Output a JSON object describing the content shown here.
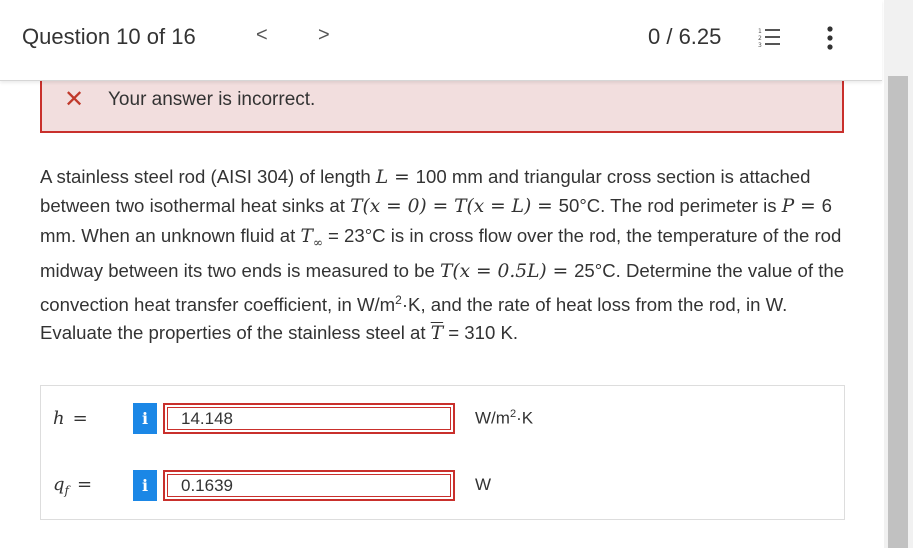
{
  "header": {
    "question_label": "Question 10 of 16",
    "prev_label": "<",
    "next_label": ">",
    "score": "0 / 6.25",
    "list_icon": "numbered-list-icon",
    "more_icon": "more-vertical-icon"
  },
  "alert": {
    "icon": "x-mark-icon",
    "message": "Your answer is incorrect.",
    "icon_color": "#c0392b",
    "background": "#f2dede",
    "border_color": "#c9302c"
  },
  "problem": {
    "t1": "A stainless steel rod (AISI 304) of length ",
    "L": "L",
    "t2": " = ",
    "t3": "100 mm and triangular cross section is attached between two isothermal heat sinks at ",
    "Tx0": "T(x = 0) = T(x = L) = ",
    "t4": "50°C. The rod perimeter is ",
    "P": "P",
    "t5": " = ",
    "t6": "6 mm. When an unknown fluid at ",
    "Tinf": "T",
    "inf_sub": "∞",
    "t7": " = 23°C is in cross flow over the rod, the temperature of the rod midway between its two ends is measured to be ",
    "Tmid": "T(x = 0.5L) = ",
    "t8": "25°C. Determine the value of the convection heat transfer coefficient, in W/m",
    "sup2": "2",
    "t9": "·K, and the rate of heat loss from the rod, in W. Evaluate the properties of the stainless steel at ",
    "Tbar": "T",
    "t10": " = 310 K."
  },
  "answers": [
    {
      "label": "h",
      "eq": "=",
      "info": "i",
      "value": "14.148",
      "unit_base": "W/m",
      "unit_sup": "2",
      "unit_tail": "·K"
    },
    {
      "label": "q",
      "label_sub": "f",
      "eq": "=",
      "info": "i",
      "value": "0.1639",
      "unit_base": "W",
      "unit_sup": "",
      "unit_tail": ""
    }
  ],
  "colors": {
    "accent": "#1b87e6",
    "error": "#c9302c"
  }
}
